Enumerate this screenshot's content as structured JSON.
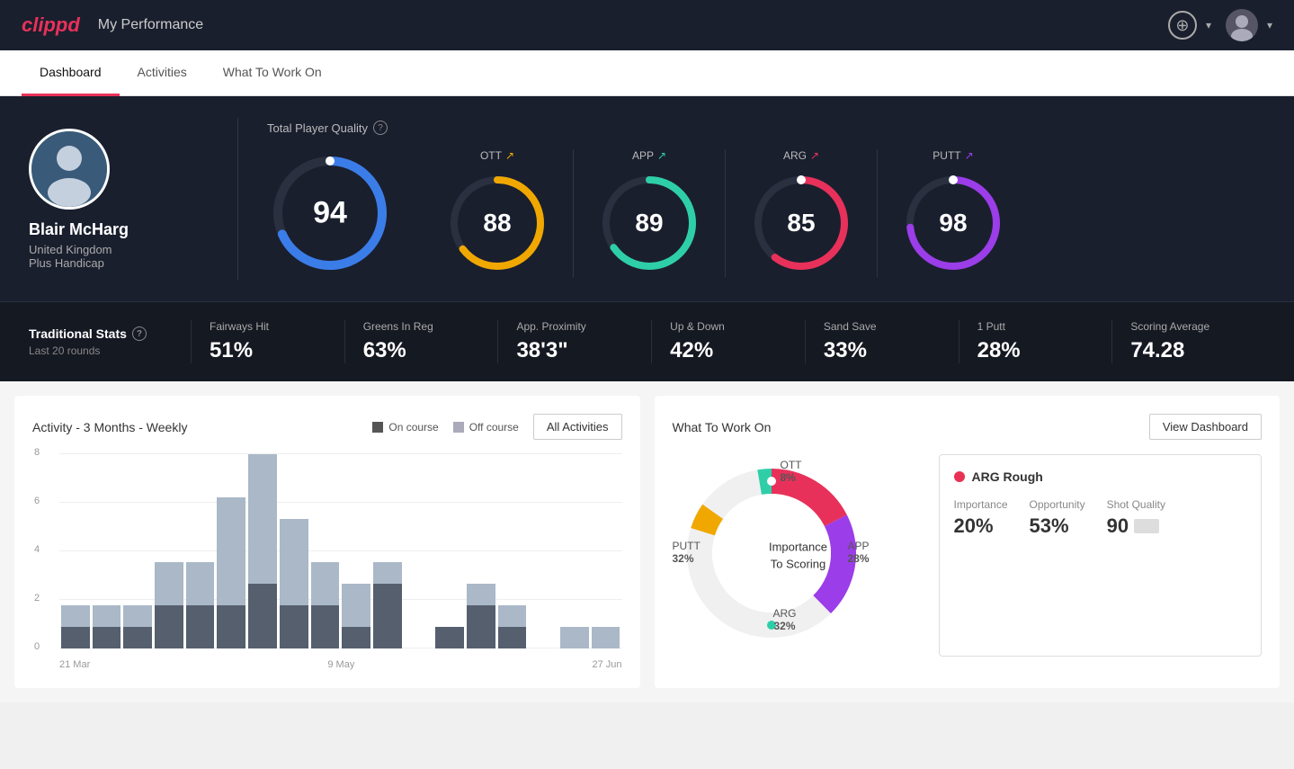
{
  "header": {
    "logo": "clippd",
    "title": "My Performance",
    "add_button_label": "+",
    "user_chevron": "▾"
  },
  "nav": {
    "tabs": [
      {
        "id": "dashboard",
        "label": "Dashboard",
        "active": true
      },
      {
        "id": "activities",
        "label": "Activities",
        "active": false
      },
      {
        "id": "what-to-work-on",
        "label": "What To Work On",
        "active": false
      }
    ]
  },
  "player": {
    "name": "Blair McHarg",
    "country": "United Kingdom",
    "handicap": "Plus Handicap"
  },
  "total_quality": {
    "label": "Total Player Quality",
    "value": 94,
    "color": "#3b7de8"
  },
  "metrics": [
    {
      "label": "OTT",
      "value": 88,
      "color": "#f0a800",
      "trend": "↗"
    },
    {
      "label": "APP",
      "value": 89,
      "color": "#2ecfa8",
      "trend": "↗"
    },
    {
      "label": "ARG",
      "value": 85,
      "color": "#e8315a",
      "trend": "↗"
    },
    {
      "label": "PUTT",
      "value": 98,
      "color": "#9b3de8",
      "trend": "↗"
    }
  ],
  "traditional_stats": {
    "title": "Traditional Stats",
    "subtitle": "Last 20 rounds",
    "items": [
      {
        "label": "Fairways Hit",
        "value": "51%"
      },
      {
        "label": "Greens In Reg",
        "value": "63%"
      },
      {
        "label": "App. Proximity",
        "value": "38'3\""
      },
      {
        "label": "Up & Down",
        "value": "42%"
      },
      {
        "label": "Sand Save",
        "value": "33%"
      },
      {
        "label": "1 Putt",
        "value": "28%"
      },
      {
        "label": "Scoring Average",
        "value": "74.28"
      }
    ]
  },
  "activity_chart": {
    "title": "Activity - 3 Months - Weekly",
    "legend": {
      "on_course": "On course",
      "off_course": "Off course"
    },
    "all_activities_label": "All Activities",
    "x_labels": [
      "21 Mar",
      "9 May",
      "27 Jun"
    ],
    "y_labels": [
      "0",
      "2",
      "4",
      "6",
      "8"
    ],
    "bars": [
      {
        "on": 1,
        "off": 1
      },
      {
        "on": 1,
        "off": 1
      },
      {
        "on": 1,
        "off": 1
      },
      {
        "on": 2,
        "off": 2
      },
      {
        "on": 2,
        "off": 2
      },
      {
        "on": 2,
        "off": 5
      },
      {
        "on": 3,
        "off": 6
      },
      {
        "on": 2,
        "off": 4
      },
      {
        "on": 2,
        "off": 2
      },
      {
        "on": 1,
        "off": 2
      },
      {
        "on": 3,
        "off": 1
      },
      {
        "on": 0,
        "off": 0
      },
      {
        "on": 1,
        "off": 0
      },
      {
        "on": 2,
        "off": 1
      },
      {
        "on": 1,
        "off": 1
      },
      {
        "on": 0,
        "off": 0
      },
      {
        "on": 0,
        "off": 1
      },
      {
        "on": 0,
        "off": 1
      }
    ]
  },
  "what_to_work_on": {
    "title": "What To Work On",
    "view_dashboard_label": "View Dashboard",
    "donut_center_line1": "Importance",
    "donut_center_line2": "To Scoring",
    "segments": [
      {
        "label": "OTT",
        "value": "8%",
        "color": "#f0a800"
      },
      {
        "label": "APP",
        "value": "28%",
        "color": "#2ecfa8"
      },
      {
        "label": "ARG",
        "value": "32%",
        "color": "#e8315a"
      },
      {
        "label": "PUTT",
        "value": "32%",
        "color": "#9b3de8"
      }
    ],
    "work_card": {
      "title": "ARG Rough",
      "dot_color": "#e83155",
      "metrics": [
        {
          "label": "Importance",
          "value": "20%"
        },
        {
          "label": "Opportunity",
          "value": "53%"
        },
        {
          "label": "Shot Quality",
          "value": "90"
        }
      ]
    }
  }
}
